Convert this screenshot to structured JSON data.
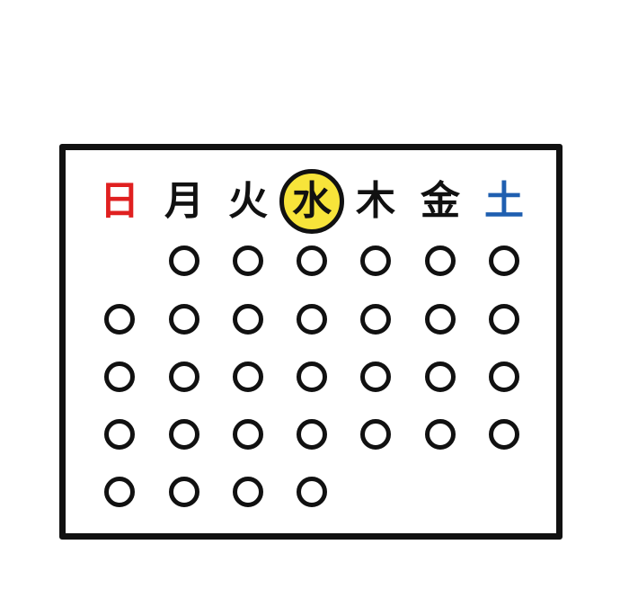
{
  "weekdays": [
    {
      "label": "日",
      "color": "#e02020",
      "highlight": false
    },
    {
      "label": "月",
      "color": "#111111",
      "highlight": false
    },
    {
      "label": "火",
      "color": "#111111",
      "highlight": false
    },
    {
      "label": "水",
      "color": "#111111",
      "highlight": true,
      "highlight_color": "#f7e43a"
    },
    {
      "label": "木",
      "color": "#111111",
      "highlight": false
    },
    {
      "label": "金",
      "color": "#111111",
      "highlight": false
    },
    {
      "label": "土",
      "color": "#1f5fb0",
      "highlight": false
    }
  ],
  "month": {
    "first_weekday_index": 1,
    "day_count": 31
  },
  "colors": {
    "outline": "#111111",
    "background": "#ffffff"
  }
}
